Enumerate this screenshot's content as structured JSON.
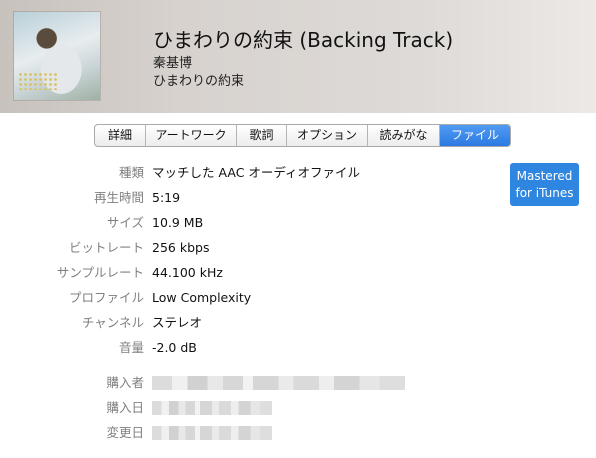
{
  "header": {
    "artwork_icon": "album-artwork",
    "title": "ひまわりの約束 (Backing Track)",
    "artist": "秦基博",
    "album": "ひまわりの約束"
  },
  "tabs": [
    {
      "label": "詳細",
      "active": false
    },
    {
      "label": "アートワーク",
      "active": false
    },
    {
      "label": "歌詞",
      "active": false
    },
    {
      "label": "オプション",
      "active": false
    },
    {
      "label": "読みがな",
      "active": false
    },
    {
      "label": "ファイル",
      "active": true
    }
  ],
  "file_info": {
    "kind_label": "種類",
    "kind_value": "マッチした AAC オーディオファイル",
    "duration_label": "再生時間",
    "duration_value": "5:19",
    "size_label": "サイズ",
    "size_value": "10.9 MB",
    "bitrate_label": "ビットレート",
    "bitrate_value": "256 kbps",
    "samplerate_label": "サンプルレート",
    "samplerate_value": "44.100 kHz",
    "profile_label": "プロファイル",
    "profile_value": "Low Complexity",
    "channels_label": "チャンネル",
    "channels_value": "ステレオ",
    "volume_label": "音量",
    "volume_value": "-2.0 dB",
    "purchaser_label": "購入者",
    "purchase_date_label": "購入日",
    "modified_label": "変更日"
  },
  "badge": {
    "line1": "Mastered",
    "line2": "for iTunes",
    "color": "#2f86e0"
  },
  "colors": {
    "active_tab": "#2c7ae2",
    "label_gray": "#808080"
  }
}
